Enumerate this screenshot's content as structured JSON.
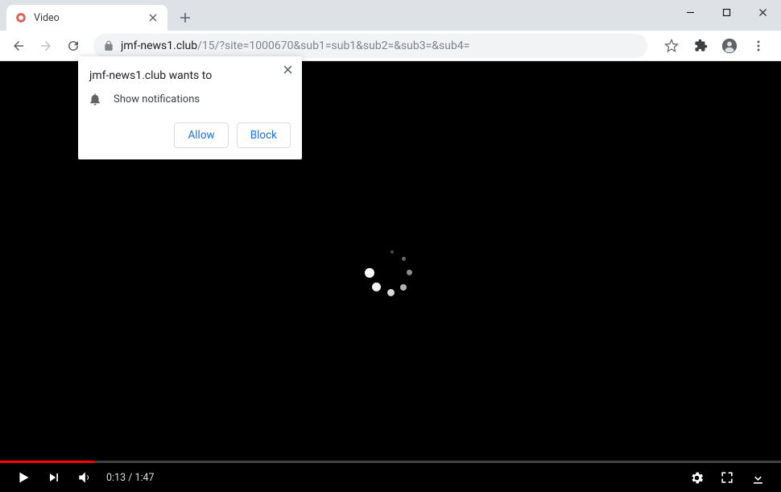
{
  "tab": {
    "title": "Video"
  },
  "url": {
    "host": "jmf-news1.club",
    "path": "/15/?site=1000670&sub1=sub1&sub2=&sub3=&sub4="
  },
  "permission": {
    "title": "jmf-news1.club wants to",
    "item": "Show notifications",
    "allow": "Allow",
    "block": "Block"
  },
  "player": {
    "current": "0:13",
    "duration": "1:47",
    "time_display": "0:13 / 1:47",
    "progress_pct": 12.1
  }
}
